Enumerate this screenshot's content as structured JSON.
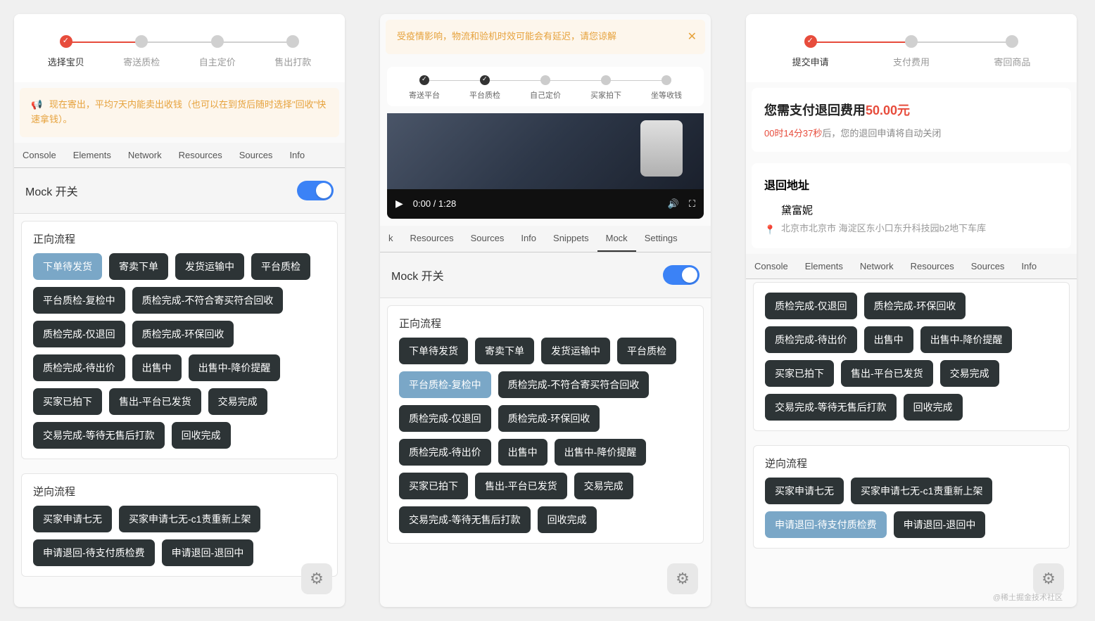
{
  "panel1": {
    "steps": [
      {
        "label": "选择宝贝",
        "done": true
      },
      {
        "label": "寄送质检",
        "done": false
      },
      {
        "label": "自主定价",
        "done": false
      },
      {
        "label": "售出打款",
        "done": false
      }
    ],
    "banner": "现在寄出，平均7天内能卖出收钱（也可以在到货后随时选择\"回收\"快速拿钱）。",
    "dev_tabs": [
      "Console",
      "Elements",
      "Network",
      "Resources",
      "Sources",
      "Info"
    ],
    "mock_label": "Mock 开关",
    "forward_title": "正向流程",
    "forward_pills": [
      {
        "t": "下单待发货",
        "sel": true
      },
      {
        "t": "寄卖下单"
      },
      {
        "t": "发货运输中"
      },
      {
        "t": "平台质检"
      },
      {
        "t": "平台质检-复检中"
      },
      {
        "t": "质检完成-不符合寄买符合回收"
      },
      {
        "t": "质检完成-仅退回"
      },
      {
        "t": "质检完成-环保回收"
      },
      {
        "t": "质检完成-待出价"
      },
      {
        "t": "出售中"
      },
      {
        "t": "出售中-降价提醒"
      },
      {
        "t": "买家已拍下"
      },
      {
        "t": "售出-平台已发货"
      },
      {
        "t": "交易完成"
      },
      {
        "t": "交易完成-等待无售后打款"
      },
      {
        "t": "回收完成"
      }
    ],
    "reverse_title": "逆向流程",
    "reverse_pills": [
      {
        "t": "买家申请七无"
      },
      {
        "t": "买家申请七无-c1责重新上架"
      },
      {
        "t": "申请退回-待支付质检费"
      },
      {
        "t": "申请退回-退回中"
      }
    ]
  },
  "panel2": {
    "banner": "受疫情影响，物流和验机时效可能会有延迟，请您谅解",
    "mini_steps": [
      {
        "label": "寄送平台",
        "done": true
      },
      {
        "label": "平台质检",
        "done": true
      },
      {
        "label": "自己定价",
        "done": false
      },
      {
        "label": "买家拍下",
        "done": false
      },
      {
        "label": "坐等收钱",
        "done": false
      }
    ],
    "video_time": "0:00 / 1:28",
    "dev_tabs": [
      "k",
      "Resources",
      "Sources",
      "Info",
      "Snippets",
      "Mock",
      "Settings"
    ],
    "dev_tab_active": "Mock",
    "mock_label": "Mock 开关",
    "forward_title": "正向流程",
    "forward_pills": [
      {
        "t": "下单待发货"
      },
      {
        "t": "寄卖下单"
      },
      {
        "t": "发货运输中"
      },
      {
        "t": "平台质检"
      },
      {
        "t": "平台质检-复检中",
        "sel": true
      },
      {
        "t": "质检完成-不符合寄买符合回收"
      },
      {
        "t": "质检完成-仅退回"
      },
      {
        "t": "质检完成-环保回收"
      },
      {
        "t": "质检完成-待出价"
      },
      {
        "t": "出售中"
      },
      {
        "t": "出售中-降价提醒"
      },
      {
        "t": "买家已拍下"
      },
      {
        "t": "售出-平台已发货"
      },
      {
        "t": "交易完成"
      },
      {
        "t": "交易完成-等待无售后打款"
      },
      {
        "t": "回收完成"
      }
    ]
  },
  "panel3": {
    "steps": [
      {
        "label": "提交申请",
        "done": true
      },
      {
        "label": "支付费用",
        "done": false
      },
      {
        "label": "寄回商品",
        "done": false
      }
    ],
    "pay_prefix": "您需支付退回费用",
    "pay_amount": "50.00元",
    "countdown_time": "00时14分37秒",
    "countdown_suffix": "后，您的退回申请将自动关闭",
    "addr_title": "退回地址",
    "addr_name": "黛富妮",
    "addr_text": "北京市北京市 海淀区东小口东升科技园b2地下车库",
    "dev_tabs": [
      "Console",
      "Elements",
      "Network",
      "Resources",
      "Sources",
      "Info"
    ],
    "forward_pills": [
      {
        "t": "质检完成-仅退回"
      },
      {
        "t": "质检完成-环保回收"
      },
      {
        "t": "质检完成-待出价"
      },
      {
        "t": "出售中"
      },
      {
        "t": "出售中-降价提醒"
      },
      {
        "t": "买家已拍下"
      },
      {
        "t": "售出-平台已发货"
      },
      {
        "t": "交易完成"
      },
      {
        "t": "交易完成-等待无售后打款"
      },
      {
        "t": "回收完成"
      }
    ],
    "reverse_title": "逆向流程",
    "reverse_pills": [
      {
        "t": "买家申请七无"
      },
      {
        "t": "买家申请七无-c1责重新上架"
      },
      {
        "t": "申请退回-待支付质检费",
        "sel": true
      },
      {
        "t": "申请退回-退回中"
      }
    ]
  },
  "watermark": "@稀土掘金技术社区"
}
